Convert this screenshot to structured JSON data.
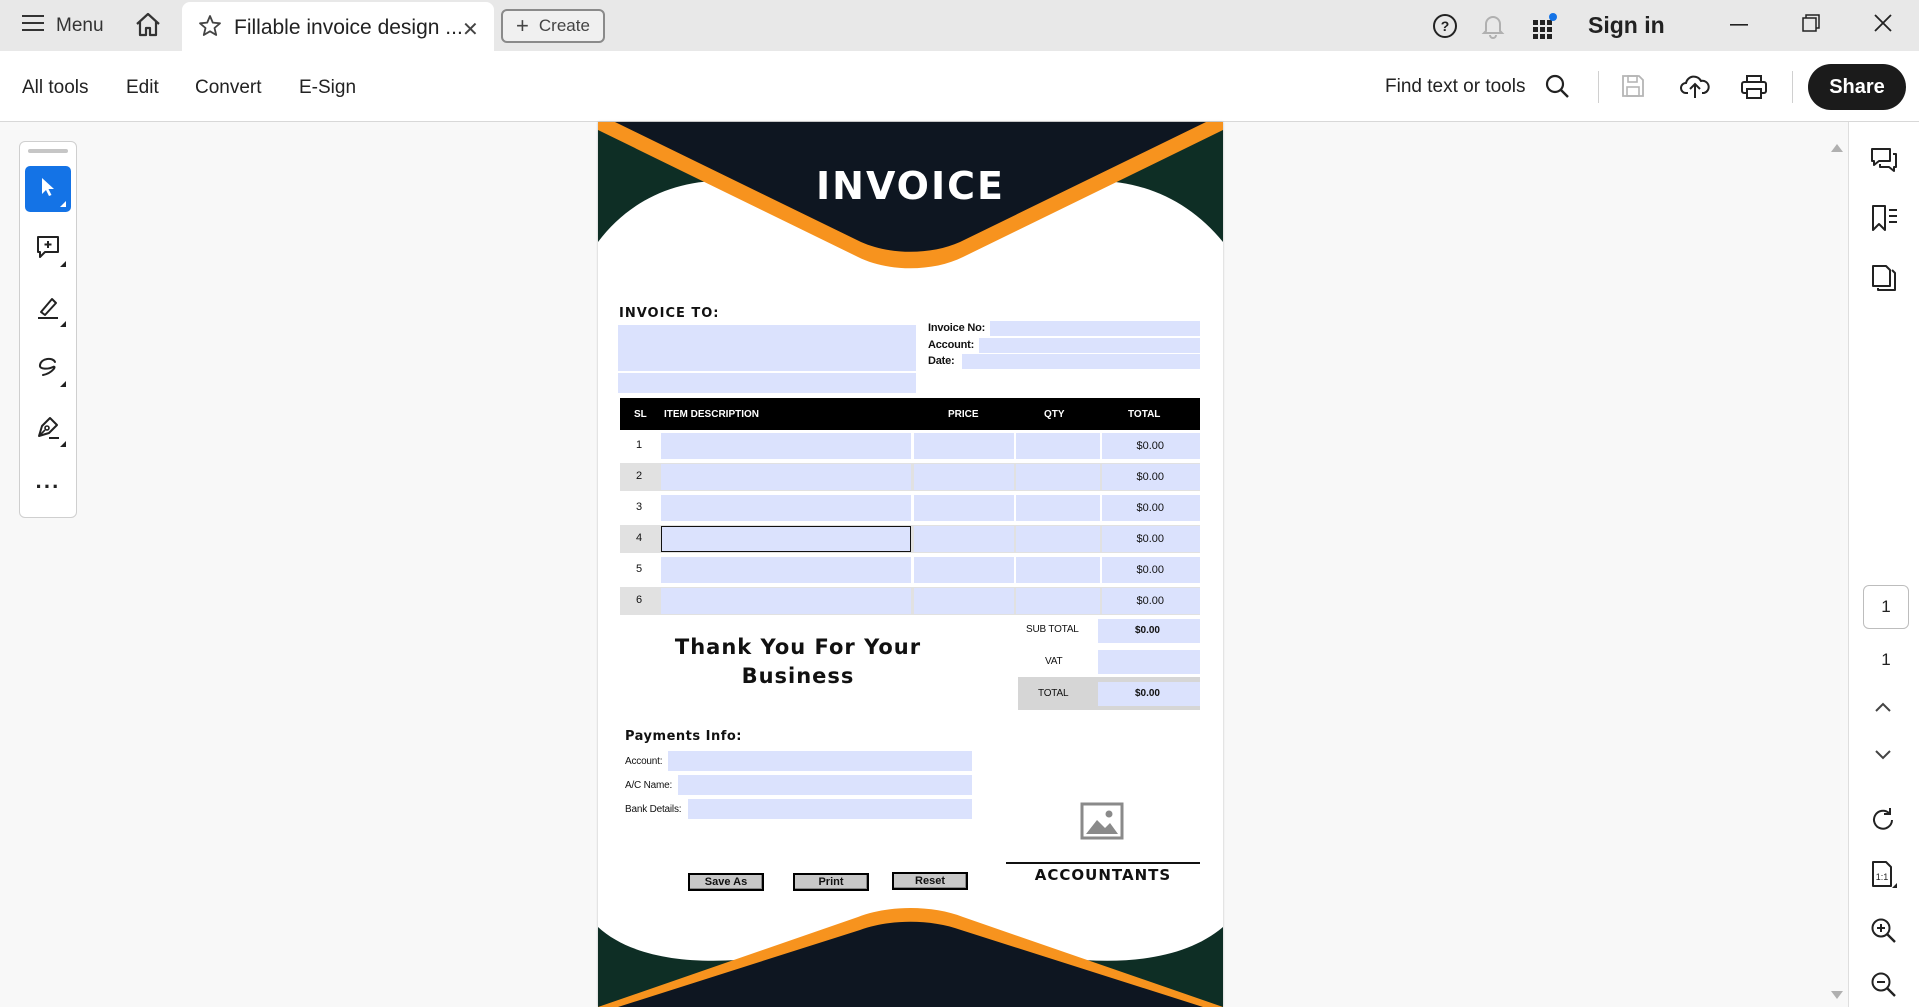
{
  "tabbar": {
    "menu_label": "Menu",
    "tab_title": "Fillable invoice design ...",
    "create_label": "Create",
    "sign_in_label": "Sign in"
  },
  "toolbar": {
    "items": [
      "All tools",
      "Edit",
      "Convert",
      "E-Sign"
    ],
    "find_label": "Find text or tools",
    "share_label": "Share"
  },
  "left_tools": [
    "select-tool",
    "add-comment-tool",
    "highlight-tool",
    "draw-tool",
    "sign-tool",
    "more-tools"
  ],
  "document": {
    "title": "INVOICE",
    "invoice_to": "INVOICE TO:",
    "meta_labels": [
      "Invoice No:",
      "Account:",
      "Date:"
    ],
    "table_headers": {
      "sl": "SL",
      "desc": "ITEM DESCRIPTION",
      "price": "PRICE",
      "qty": "QTY",
      "total": "TOTAL"
    },
    "rows": [
      {
        "sl": "1",
        "total": "$0.00"
      },
      {
        "sl": "2",
        "total": "$0.00"
      },
      {
        "sl": "3",
        "total": "$0.00"
      },
      {
        "sl": "4",
        "total": "$0.00"
      },
      {
        "sl": "5",
        "total": "$0.00"
      },
      {
        "sl": "6",
        "total": "$0.00"
      }
    ],
    "thank_you_line1": "Thank You For Your",
    "thank_you_line2": "Business",
    "subtotal_label": "SUB TOTAL",
    "subtotal_value": "$0.00",
    "vat_label": "VAT",
    "total_label": "TOTAL",
    "total_value": "$0.00",
    "payments_title": "Payments Info:",
    "payment_labels": [
      "Account:",
      "A/C Name:",
      "Bank Details:"
    ],
    "buttons": [
      "Save As",
      "Print",
      "Reset"
    ],
    "accountants_label": "ACCOUNTANTS"
  },
  "page_nav": {
    "current": "1",
    "total": "1"
  },
  "colors": {
    "accent_blue": "#1473e6",
    "field_fill": "#dbe2fd",
    "navy": "#0e1621",
    "orange": "#f7931e",
    "dark_green": "#0e2e25"
  }
}
